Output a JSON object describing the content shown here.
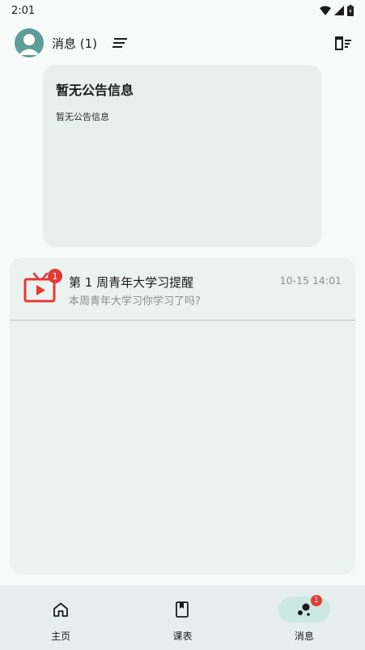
{
  "status_bar": {
    "time": "2:01"
  },
  "top_bar": {
    "title": "消息 (1)"
  },
  "notice_card": {
    "title": "暂无公告信息",
    "body": "暂无公告信息"
  },
  "messages": [
    {
      "badge": "1",
      "title": "第 1 周青年大学习提醒",
      "subtitle": "本周青年大学习你学习了吗?",
      "time": "10-15 14:01"
    }
  ],
  "bottom_nav": {
    "items": [
      {
        "label": "主页",
        "icon": "home-icon"
      },
      {
        "label": "课表",
        "icon": "book-icon"
      },
      {
        "label": "消息",
        "icon": "bubbles-icon",
        "badge": "1",
        "active": true
      }
    ]
  },
  "colors": {
    "accent": "#5d9e98",
    "badge": "#e53935",
    "tv_icon": "#e53935"
  }
}
